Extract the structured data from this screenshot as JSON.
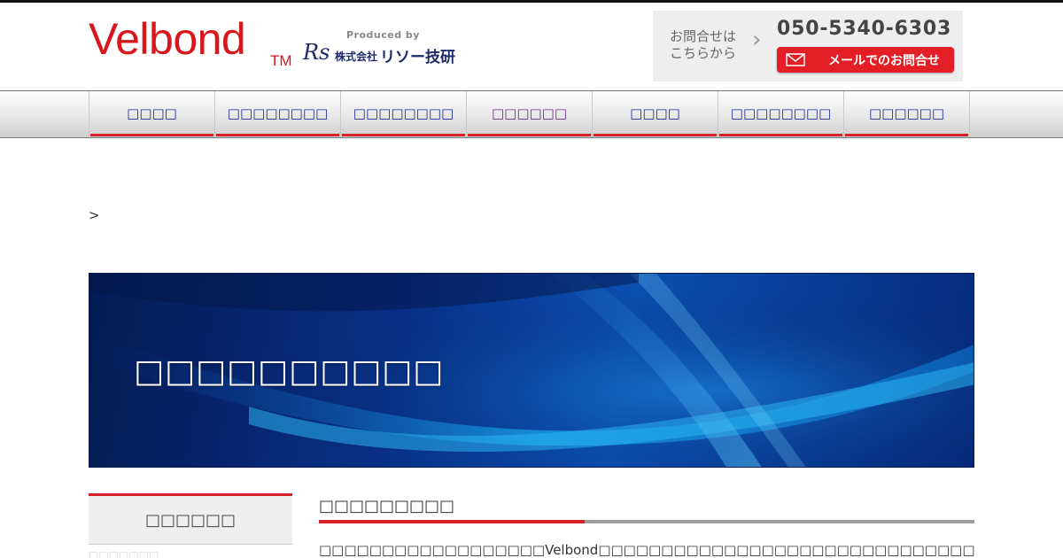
{
  "header": {
    "brand": "Velbond",
    "tm": "TM",
    "produced_by": "Produced by",
    "company_logo": "Rs",
    "company_prefix": "株式会社",
    "company_name": "リソー技研",
    "contact_label": "お問合せは こちらから",
    "phone": "050-5340-6303",
    "mail_button": "メールでのお問合せ"
  },
  "nav": {
    "items": [
      {
        "label": "□□□□"
      },
      {
        "label": "□□□□□□□□"
      },
      {
        "label": "□□□□□□□□"
      },
      {
        "label": "□□□□□□",
        "active": true
      },
      {
        "label": "□□□□"
      },
      {
        "label": "□□□□□□□□"
      },
      {
        "label": "□□□□□□"
      }
    ]
  },
  "breadcrumb": ">",
  "hero": {
    "title": "□□□□□□□□□□"
  },
  "sidebar": {
    "title": "□□□□□□",
    "faded_text": "□□□□□□□"
  },
  "main": {
    "heading": "□□□□□□□□□",
    "text": "□□□□□□□□□□□□□□□□□□Velbond□□□□□□□□□□□□□□□□□□□□□□□□□□□□□□□□□□□□□□□□□□□□□□□□□□□"
  },
  "colors": {
    "brand_red": "#d9161c",
    "nav_text": "#1b2a9c",
    "nav_active_text": "#6a2b87",
    "accent_red": "#d62027",
    "company_navy": "#1d2a6b"
  },
  "icons": {
    "contact_chevron": "chevron-right-icon",
    "mail": "envelope-icon"
  }
}
